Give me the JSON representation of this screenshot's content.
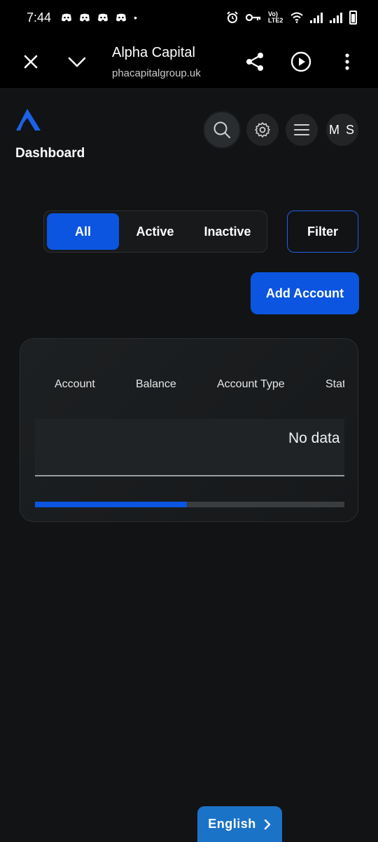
{
  "status_bar": {
    "time": "7:44",
    "notification_icons": [
      "discord-icon",
      "discord-icon",
      "discord-icon",
      "discord-icon"
    ],
    "dot": "•",
    "right_icons": [
      "alarm-icon",
      "key-icon",
      "volte-icon",
      "wifi-icon",
      "signal-icon",
      "signal-icon",
      "battery-icon"
    ],
    "volte_label": "Vo) LTE2"
  },
  "browser": {
    "title": "Alpha Capital",
    "url": "phacapitalgroup.uk"
  },
  "header": {
    "page_title": "Dashboard",
    "avatar_initials": "M S"
  },
  "filters": {
    "tabs": [
      {
        "label": "All",
        "selected": true
      },
      {
        "label": "Active",
        "selected": false
      },
      {
        "label": "Inactive",
        "selected": false
      }
    ],
    "filter_label": "Filter"
  },
  "actions": {
    "add_account_label": "Add Account"
  },
  "table": {
    "columns": [
      "Account",
      "Balance",
      "Account Type",
      "Status"
    ],
    "empty_text": "No data",
    "scroll_fraction": 0.49
  },
  "footer": {
    "language_label": "English",
    "language_arrow": "›"
  },
  "colors": {
    "accent": "#0b55e0",
    "background": "#121314",
    "language_button": "#1b73c7"
  }
}
